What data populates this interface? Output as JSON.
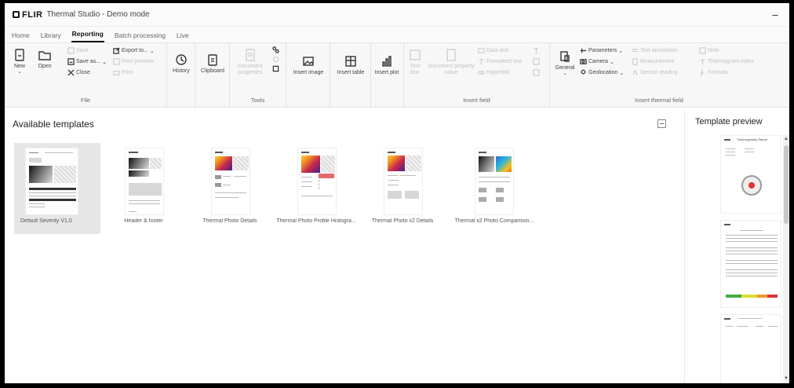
{
  "app": {
    "logo": "FLIR",
    "title": "Thermal Studio - Demo mode",
    "minimize": "–"
  },
  "tabs": [
    {
      "label": "Home",
      "active": false
    },
    {
      "label": "Library",
      "active": false
    },
    {
      "label": "Reporting",
      "active": true
    },
    {
      "label": "Batch processing",
      "active": false
    },
    {
      "label": "Live",
      "active": false
    }
  ],
  "ribbon": {
    "file": {
      "label": "File",
      "new": "New",
      "open": "Open",
      "save": "Save",
      "save_as": "Save as...",
      "close": "Close",
      "export": "Export to...",
      "print_preview": "Print preview",
      "print": "Print"
    },
    "history": "History",
    "clipboard": "Clipboard",
    "tools": {
      "label": "Tools",
      "document_properties": "Document properties"
    },
    "insert_image": "Insert image",
    "insert_table": "Insert table",
    "insert_plot": "Insert plot",
    "insert_field": {
      "label": "Insert field",
      "text_box": "Text box",
      "document_property_value": "Document property value",
      "data_text": "Data text",
      "formatted_text": "Formatted text",
      "hyperlink": "Hyperlink"
    },
    "insert_thermal_field": {
      "label": "Insert thermal field",
      "general": "General",
      "parameters": "Parameters",
      "camera": "Camera",
      "geolocation": "Geolocation",
      "text_annotation": "Text annotation",
      "measurement": "Measurement",
      "sensor_reading": "Sensor reading",
      "note": "Note",
      "thermogram_index": "Thermogram index",
      "formula": "Formula"
    }
  },
  "available_templates": {
    "title": "Available templates",
    "items": [
      {
        "name": "Default Severity V1.0",
        "selected": true
      },
      {
        "name": "Header & footer",
        "selected": false
      },
      {
        "name": "Thermal Photo Details",
        "selected": false
      },
      {
        "name": "Thermal Photo Profile Histogra...",
        "selected": false
      },
      {
        "name": "Thermal Photo x2 Details",
        "selected": false
      },
      {
        "name": "Thermal x2 Photo Comparison...",
        "selected": false
      }
    ]
  },
  "template_preview": {
    "title": "Template preview",
    "report_heading": "Thermography Report"
  },
  "colors": {
    "accent": "#111111",
    "selected_bg": "#e6e6e6",
    "ribbon_bg": "#f7f7f7"
  }
}
